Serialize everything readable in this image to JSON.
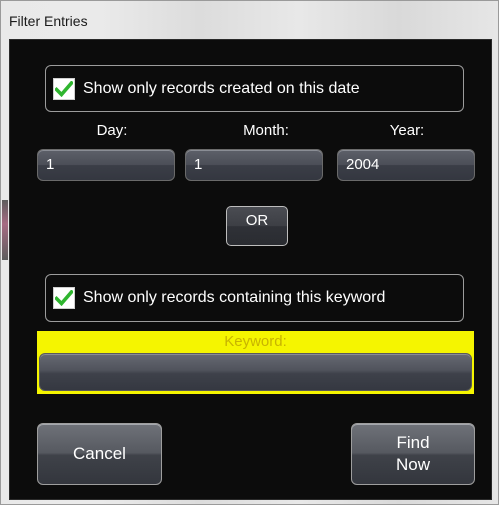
{
  "window": {
    "title": "Filter Entries"
  },
  "date_filter": {
    "checkbox_label": "Show only records created on this date",
    "checked": true,
    "day": {
      "label": "Day:",
      "value": "1"
    },
    "month": {
      "label": "Month:",
      "value": "1"
    },
    "year": {
      "label": "Year:",
      "value": "2004"
    }
  },
  "or_button": {
    "label": "OR"
  },
  "keyword_filter": {
    "checkbox_label": "Show only records containing this keyword",
    "checked": true,
    "field_label": "Keyword:",
    "value": ""
  },
  "actions": {
    "cancel_label": "Cancel",
    "find_label": "Find\nNow"
  },
  "colors": {
    "check_green": "#2fb52f",
    "keyword_highlight": "#f5f500"
  },
  "icons": {
    "checkmark": "checkmark-icon"
  }
}
